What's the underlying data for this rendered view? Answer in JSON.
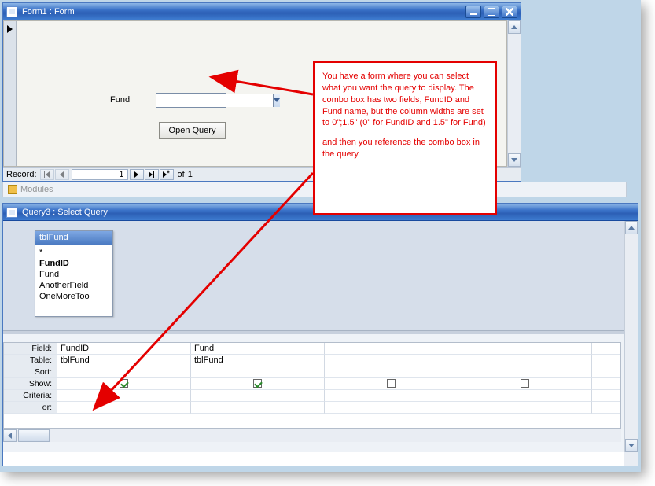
{
  "form_window": {
    "title": "Form1 : Form",
    "fund_label": "Fund",
    "combo_value": "",
    "open_query_label": "Open Query",
    "record_nav": {
      "label": "Record:",
      "current": "1",
      "of_label": "of",
      "total": "1"
    }
  },
  "midbar": {
    "text": "Modules"
  },
  "query_window": {
    "title": "Query3 : Select Query",
    "table": {
      "name": "tblFund",
      "fields": [
        "*",
        "FundID",
        "Fund",
        "AnotherField",
        "OneMoreToo"
      ]
    },
    "grid": {
      "labels": [
        "Field:",
        "Table:",
        "Sort:",
        "Show:",
        "Criteria:",
        "or:"
      ],
      "cols": [
        {
          "field": "FundID",
          "table": "tblFund",
          "show": true
        },
        {
          "field": "Fund",
          "table": "tblFund",
          "show": true
        },
        {
          "field": "",
          "table": "",
          "show": false
        },
        {
          "field": "",
          "table": "",
          "show": false
        }
      ]
    }
  },
  "callout": {
    "p1": "You have a form where you can select what you want the query to display. The combo box has two fields, FundID and Fund name, but the column widths are set to 0\";1.5\" (0\" for FundID and 1.5\" for Fund)",
    "p2": "and then you reference the combo box in the query."
  }
}
